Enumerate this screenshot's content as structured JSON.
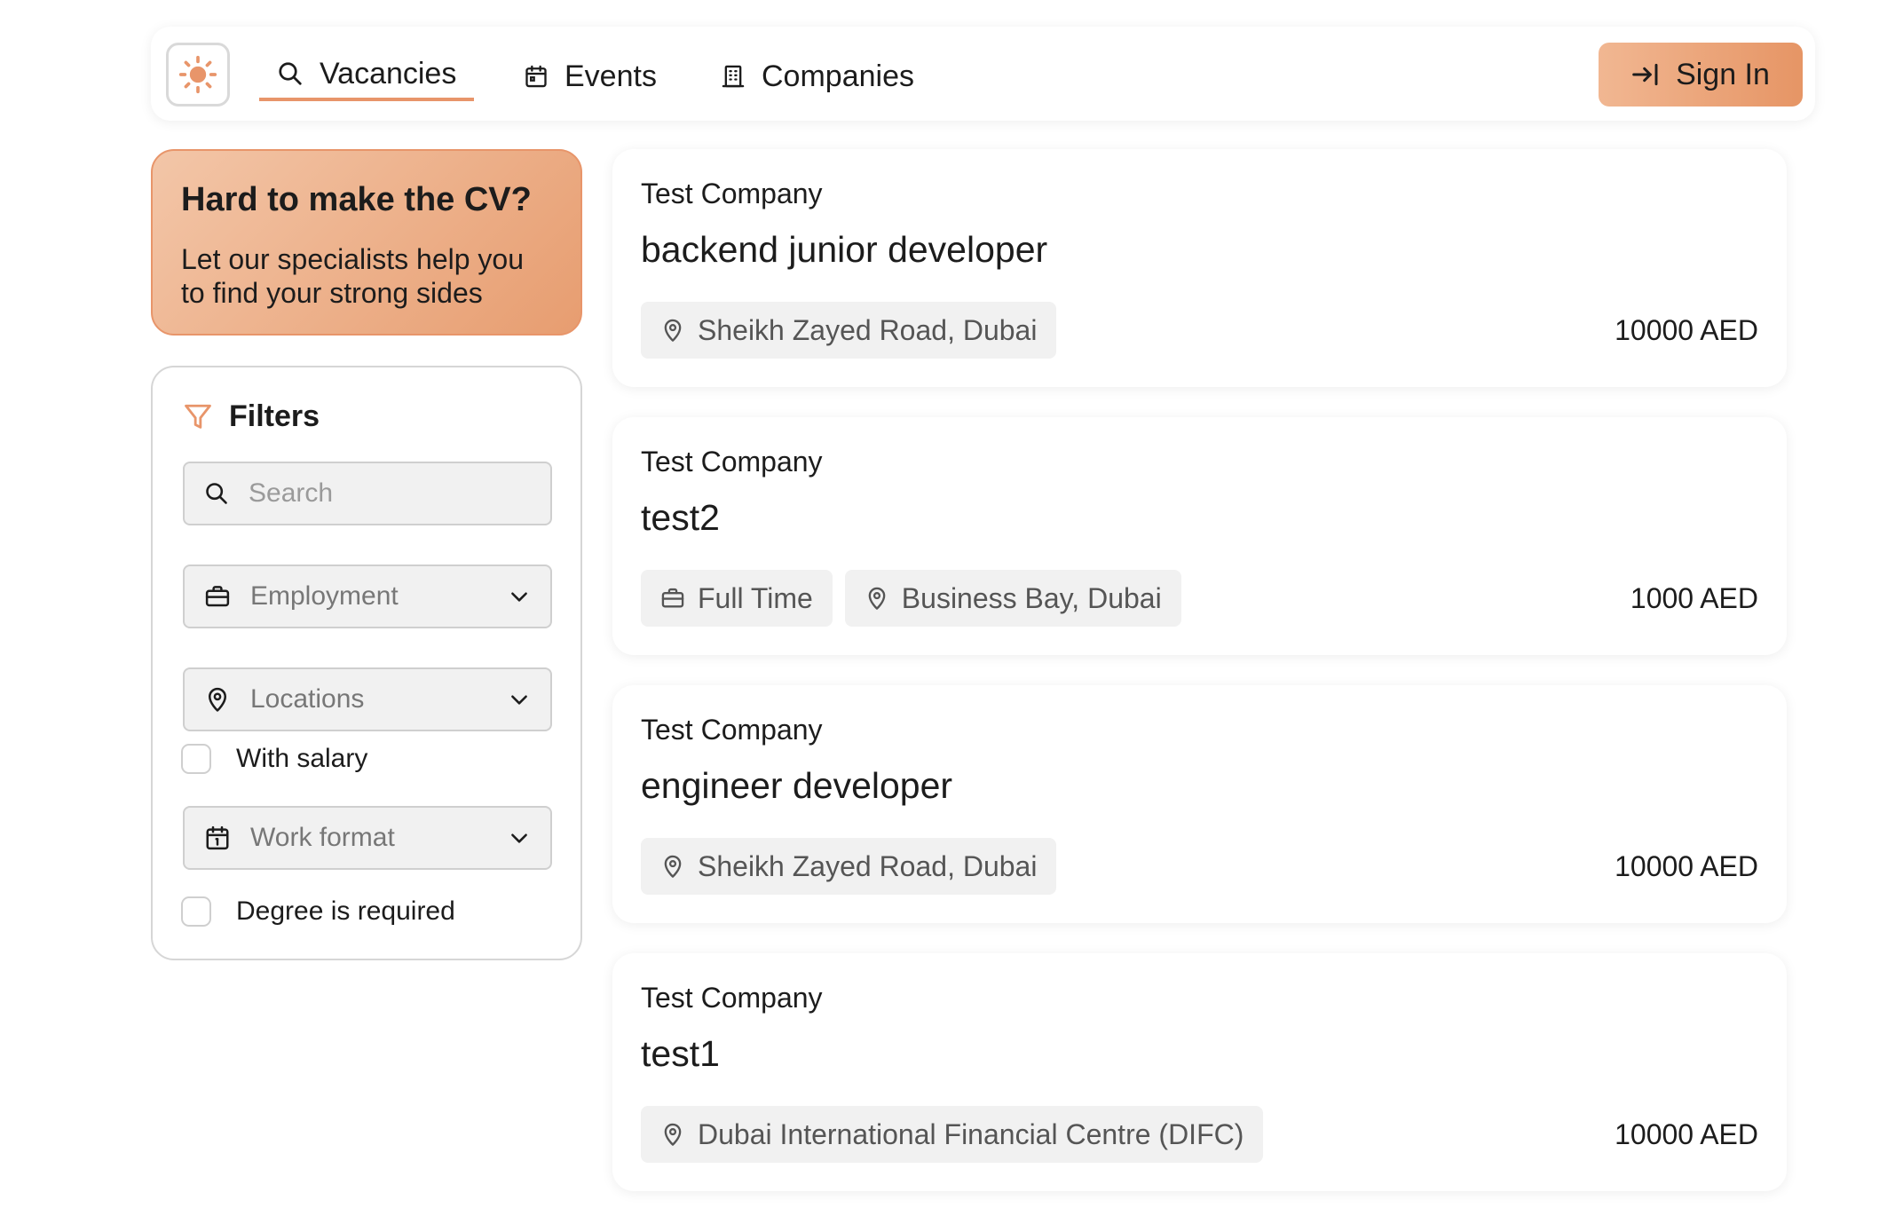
{
  "header": {
    "logo_icon": "sun-icon",
    "tabs": [
      {
        "label": "Vacancies",
        "icon": "search-icon",
        "active": true
      },
      {
        "label": "Events",
        "icon": "calendar-icon",
        "active": false
      },
      {
        "label": "Companies",
        "icon": "building-icon",
        "active": false
      }
    ],
    "signin_label": "Sign In",
    "signin_icon": "arrow-to-line-icon"
  },
  "promo": {
    "title": "Hard to make the CV?",
    "text": "Let our specialists help you to find your strong sides"
  },
  "filters": {
    "title": "Filters",
    "search_placeholder": "Search",
    "employment_label": "Employment",
    "locations_label": "Locations",
    "with_salary_label": "With salary",
    "work_format_label": "Work format",
    "degree_label": "Degree is required"
  },
  "vacancies": [
    {
      "company": "Test Company",
      "title": "backend junior developer",
      "employment": "",
      "location": "Sheikh Zayed Road, Dubai",
      "salary": "10000 AED"
    },
    {
      "company": "Test Company",
      "title": "test2",
      "employment": "Full Time",
      "location": "Business Bay, Dubai",
      "salary": "1000 AED"
    },
    {
      "company": "Test Company",
      "title": "engineer developer",
      "employment": "",
      "location": "Sheikh Zayed Road, Dubai",
      "salary": "10000 AED"
    },
    {
      "company": "Test Company",
      "title": "test1",
      "employment": "",
      "location": "Dubai International Financial Centre (DIFC)",
      "salary": "10000 AED"
    }
  ],
  "colors": {
    "accent": "#e8956a",
    "accent_light": "#f3c6a8",
    "tag_bg": "#f1f1f1"
  }
}
